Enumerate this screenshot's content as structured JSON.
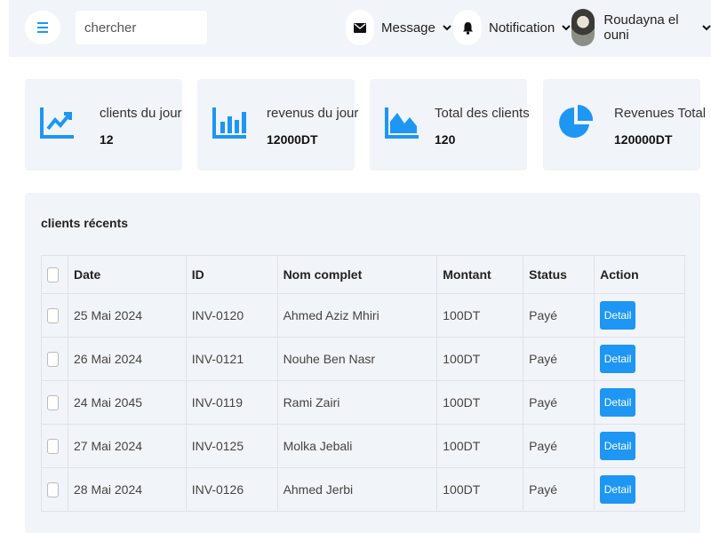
{
  "header": {
    "search_placeholder": "chercher",
    "message_label": "Message",
    "notification_label": "Notification",
    "user_name": "Roudayna el ouni"
  },
  "stats": [
    {
      "title": "clients du jour",
      "value": "12",
      "icon": "line-chart-icon"
    },
    {
      "title": "revenus du jour",
      "value": "12000DT",
      "icon": "bar-chart-icon"
    },
    {
      "title": "Total des clients",
      "value": "120",
      "icon": "area-chart-icon"
    },
    {
      "title": "Revenues Total",
      "value": "120000DT",
      "icon": "pie-chart-icon"
    }
  ],
  "recent": {
    "title": "clients récents",
    "columns": [
      "Date",
      "ID",
      "Nom complet",
      "Montant",
      "Status",
      "Action"
    ],
    "rows": [
      {
        "date": "25 Mai 2024",
        "id": "INV-0120",
        "name": "Ahmed Aziz Mhiri",
        "amount": "100DT",
        "status": "Payé",
        "action": "Detail"
      },
      {
        "date": "26 Mai 2024",
        "id": "INV-0121",
        "name": "Nouhe Ben Nasr",
        "amount": "100DT",
        "status": "Payé",
        "action": "Detail"
      },
      {
        "date": "24 Mai 2045",
        "id": "INV-0119",
        "name": "Rami Zairi",
        "amount": "100DT",
        "status": "Payé",
        "action": "Detail"
      },
      {
        "date": "27 Mai 2024",
        "id": "INV-0125",
        "name": "Molka Jebali",
        "amount": "100DT",
        "status": "Payé",
        "action": "Detail"
      },
      {
        "date": "28 Mai 2024",
        "id": "INV-0126",
        "name": "Ahmed Jerbi",
        "amount": "100DT",
        "status": "Payé",
        "action": "Detail"
      }
    ]
  },
  "colors": {
    "accent": "#1e96f3",
    "panel": "#f1f4f8"
  }
}
